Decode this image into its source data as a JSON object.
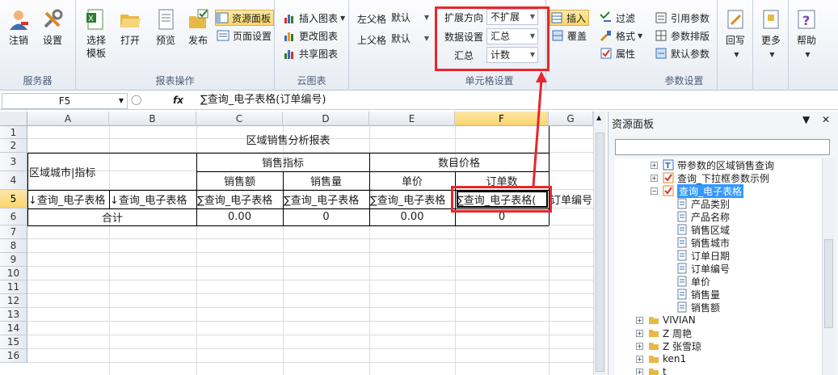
{
  "ribbon": {
    "groups": {
      "server": {
        "label": "服务器",
        "logout": "注销",
        "settings": "设置"
      },
      "report": {
        "label": "报表操作",
        "select_template": "选择模板",
        "open": "打开",
        "preview": "预览",
        "publish": "发布"
      },
      "resource_panel_btn": "资源面板",
      "page_setup_btn": "页面设置",
      "cloud": {
        "label": "云图表",
        "insert_chart": "插入图表",
        "change_chart": "更改图表",
        "share_chart": "共享图表"
      },
      "parent": {
        "left_label": "左父格",
        "left_value": "默认",
        "up_label": "上父格",
        "up_value": "默认"
      },
      "cell": {
        "label": "单元格设置",
        "expand_label": "扩展方向",
        "expand_value": "不扩展",
        "data_label": "数据设置",
        "data_value": "汇总",
        "summary_label": "汇总",
        "summary_value": "计数"
      },
      "insert": "插入",
      "cover": "覆盖",
      "filter": "过滤",
      "format": "格式",
      "attribute": "属性",
      "params": {
        "label": "参数设置",
        "ref_param": "引用参数",
        "param_layout": "参数排版",
        "default_param": "默认参数"
      },
      "writeback": "回写",
      "more": "更多",
      "help": "帮助"
    }
  },
  "formula_bar": {
    "name_box": "F5",
    "fx": "fx",
    "formula": "∑查询_电子表格(订单编号)"
  },
  "sheet": {
    "columns": [
      "A",
      "B",
      "C",
      "D",
      "E",
      "F",
      "G"
    ],
    "selected_column": "F",
    "rows": [
      "1",
      "2",
      "3",
      "4",
      "5",
      "6",
      "7",
      "8",
      "9",
      "10",
      "11",
      "12",
      "13",
      "14",
      "15",
      "16"
    ],
    "selected_row": "5",
    "title": "区域销售分析报表",
    "corner_header": "区域城市|指标",
    "group_sales": "销售指标",
    "group_price": "数目价格",
    "sub_headers": [
      "销售额",
      "销售量",
      "单价",
      "订单数"
    ],
    "row5": [
      "↓查询_电子表格",
      "↓查询_电子表格",
      "∑查询_电子表格",
      "∑查询_电子表格",
      "∑查询_电子表格",
      "∑查询_电子表格("
    ],
    "g5_overflow": "订单编号",
    "total_label": "合计",
    "totals": [
      "0.00",
      "0",
      "0.00",
      "0"
    ]
  },
  "panel": {
    "title": "资源面板",
    "tree": [
      {
        "label": "带参数的区域销售查询",
        "type": "text-query"
      },
      {
        "label": "查询_下拉框参数示例",
        "type": "query"
      },
      {
        "label": "查询_电子表格",
        "type": "query",
        "selected": true
      },
      {
        "label": "产品类别",
        "type": "field"
      },
      {
        "label": "产品名称",
        "type": "field"
      },
      {
        "label": "销售区域",
        "type": "field"
      },
      {
        "label": "销售城市",
        "type": "field"
      },
      {
        "label": "订单日期",
        "type": "field"
      },
      {
        "label": "订单编号",
        "type": "field"
      },
      {
        "label": "单价",
        "type": "field"
      },
      {
        "label": "销售量",
        "type": "field"
      },
      {
        "label": "销售额",
        "type": "field"
      },
      {
        "label": "VIVIAN",
        "type": "folder"
      },
      {
        "label": "Z 周艳",
        "type": "folder"
      },
      {
        "label": "Z 张雪琼",
        "type": "folder"
      },
      {
        "label": "ken1",
        "type": "folder"
      },
      {
        "label": "t",
        "type": "folder"
      }
    ]
  },
  "colors": {
    "highlight": "#e8262c",
    "selection_fill": "#fcd66b",
    "tree_selection": "#3399ff"
  }
}
